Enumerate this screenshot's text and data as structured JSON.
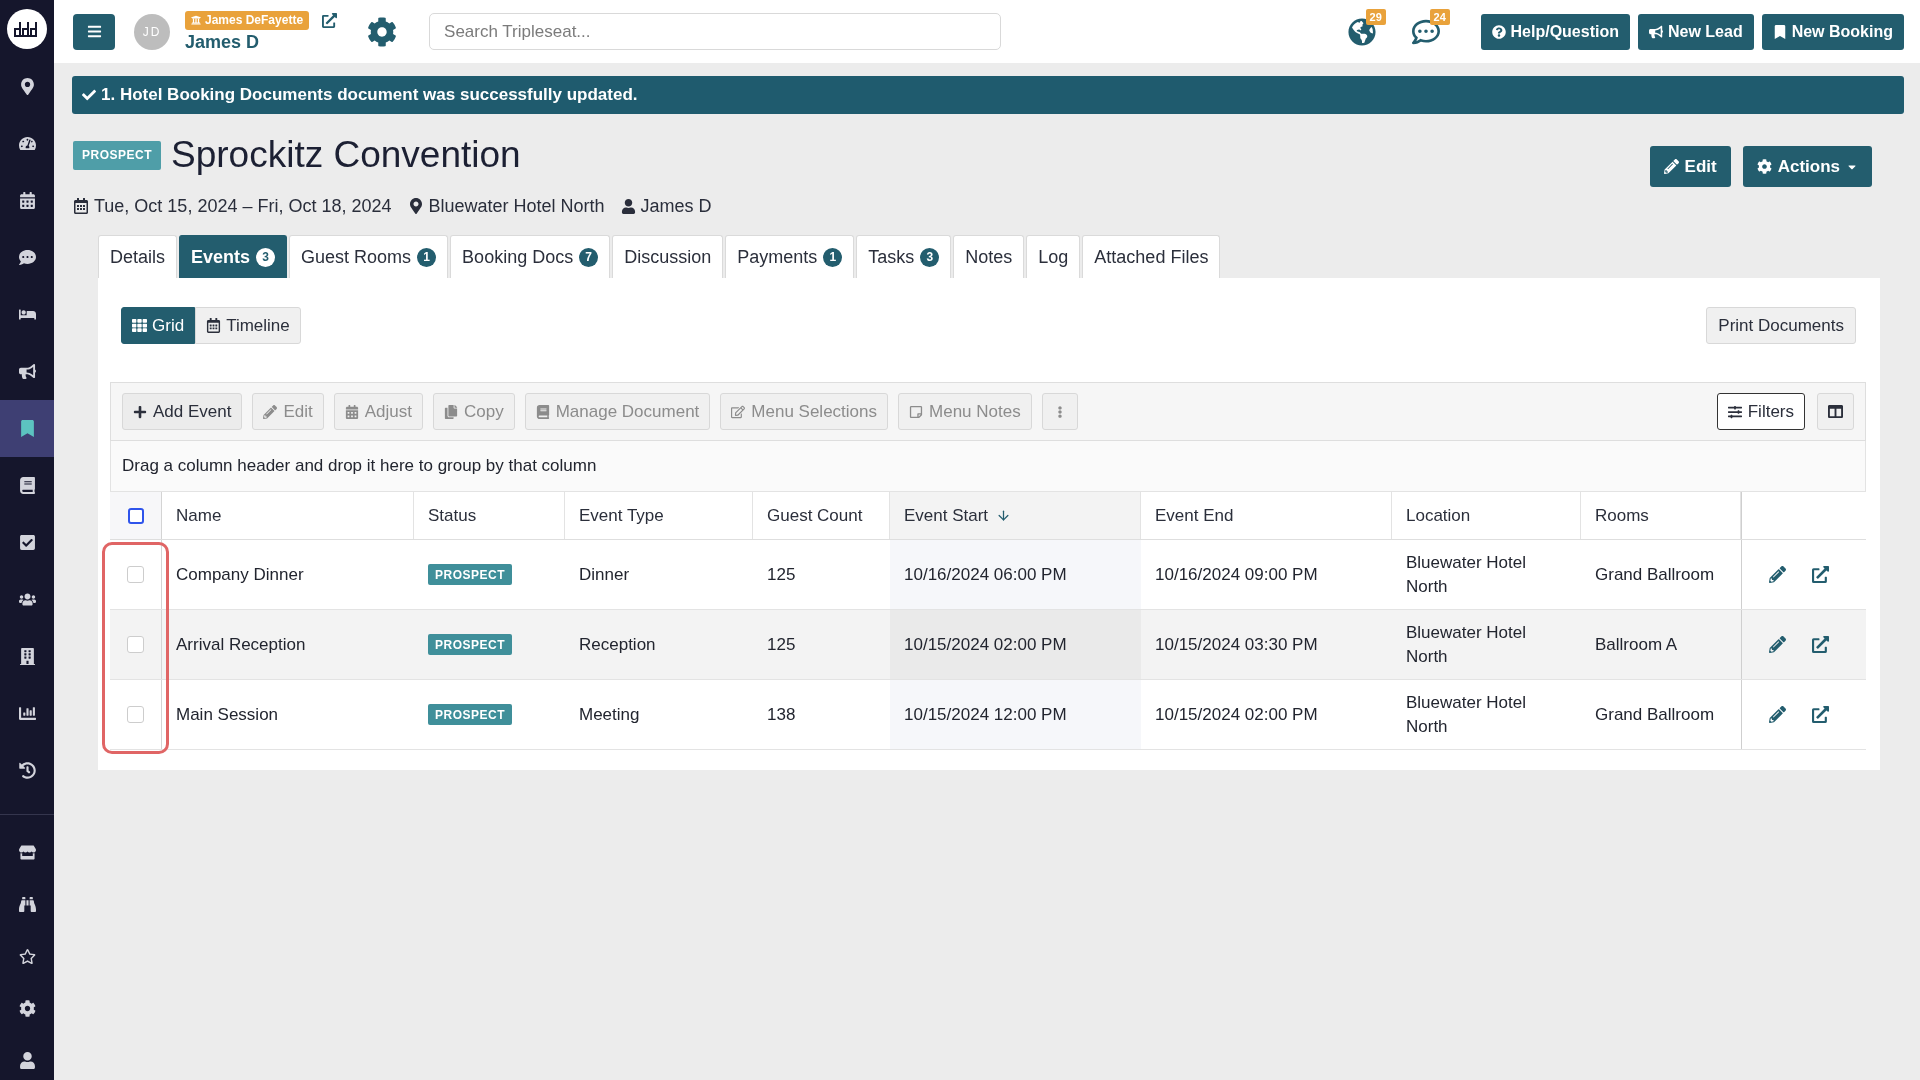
{
  "sidebar": {
    "primary": [
      {
        "selected": false
      },
      {
        "selected": false
      },
      {
        "selected": false
      },
      {
        "selected": false
      },
      {
        "selected": false
      },
      {
        "selected": false
      },
      {
        "selected": true
      },
      {
        "selected": false
      },
      {
        "selected": false
      },
      {
        "selected": false
      },
      {
        "selected": false
      },
      {
        "selected": false
      },
      {
        "selected": false
      }
    ],
    "secondary": [
      {
        "selected": false
      },
      {
        "selected": false
      },
      {
        "selected": false
      },
      {
        "selected": false
      },
      {
        "selected": false
      }
    ]
  },
  "top_bar": {
    "user": {
      "initials": "JD",
      "account": "James DeFayette",
      "name": "James D"
    },
    "search": {
      "placeholder": "Search Tripleseat..."
    },
    "notifications": [
      {
        "count": "29"
      },
      {
        "count": "24"
      }
    ],
    "buttons": [
      "Help/Question",
      "New Lead",
      "New Booking"
    ]
  },
  "alert": {
    "message": "1. Hotel Booking Documents document was successfully updated."
  },
  "booking": {
    "status": "PROSPECT",
    "title": "Sprockitz Convention",
    "dates": "Tue, Oct 15, 2024 – Fri, Oct 18, 2024",
    "venue": "Bluewater Hotel North",
    "owner": "James D",
    "buttons": [
      "Edit",
      "Actions"
    ]
  },
  "tabs": [
    {
      "label": "Details",
      "selected": false
    },
    {
      "label": "Events",
      "count": "3",
      "selected": true
    },
    {
      "label": "Guest Rooms",
      "count": "1",
      "selected": false
    },
    {
      "label": "Booking Docs",
      "count": "7",
      "selected": false
    },
    {
      "label": "Discussion",
      "selected": false
    },
    {
      "label": "Payments",
      "count": "1",
      "selected": false
    },
    {
      "label": "Tasks",
      "count": "3",
      "selected": false
    },
    {
      "label": "Notes",
      "selected": false
    },
    {
      "label": "Log",
      "selected": false
    },
    {
      "label": "Attached Files",
      "selected": false
    }
  ],
  "views": [
    {
      "label": "Grid",
      "selected": true
    },
    {
      "label": "Timeline",
      "selected": false
    }
  ],
  "print_button": "Print Documents",
  "toolbar": {
    "buttons": [
      {
        "label": "Add Event",
        "disabled": false
      },
      {
        "label": "Edit",
        "disabled": true
      },
      {
        "label": "Adjust",
        "disabled": true
      },
      {
        "label": "Copy",
        "disabled": true
      },
      {
        "label": "Manage Document",
        "disabled": true
      },
      {
        "label": "Menu Selections",
        "disabled": true
      },
      {
        "label": "Menu Notes",
        "disabled": true
      }
    ],
    "filters": "Filters"
  },
  "group_hint": "Drag a column header and drop it here to group by that column",
  "table": {
    "select_all": {
      "checked": false
    },
    "columns": [
      {
        "label": "Name",
        "sorted": false
      },
      {
        "label": "Status",
        "sorted": false
      },
      {
        "label": "Event Type",
        "sorted": false
      },
      {
        "label": "Guest Count",
        "sorted": false
      },
      {
        "label": "Event Start",
        "sorted": true
      },
      {
        "label": "Event End",
        "sorted": false
      },
      {
        "label": "Location",
        "sorted": false
      },
      {
        "label": "Rooms",
        "sorted": false
      }
    ],
    "rows": [
      {
        "checked": false,
        "name": "Company Dinner",
        "status": "PROSPECT",
        "event_type": "Dinner",
        "guest_count": "125",
        "event_start": "10/16/2024 06:00 PM",
        "event_end": "10/16/2024 09:00 PM",
        "location": "Bluewater Hotel North",
        "rooms": "Grand Ballroom"
      },
      {
        "checked": false,
        "name": "Arrival Reception",
        "status": "PROSPECT",
        "event_type": "Reception",
        "guest_count": "125",
        "event_start": "10/15/2024 02:00 PM",
        "event_end": "10/15/2024 03:30 PM",
        "location": "Bluewater Hotel North",
        "rooms": "Ballroom A"
      },
      {
        "checked": false,
        "name": "Main Session",
        "status": "PROSPECT",
        "event_type": "Meeting",
        "guest_count": "138",
        "event_start": "10/15/2024 12:00 PM",
        "event_end": "10/15/2024 02:00 PM",
        "location": "Bluewater Hotel North",
        "rooms": "Grand Ballroom"
      }
    ]
  }
}
